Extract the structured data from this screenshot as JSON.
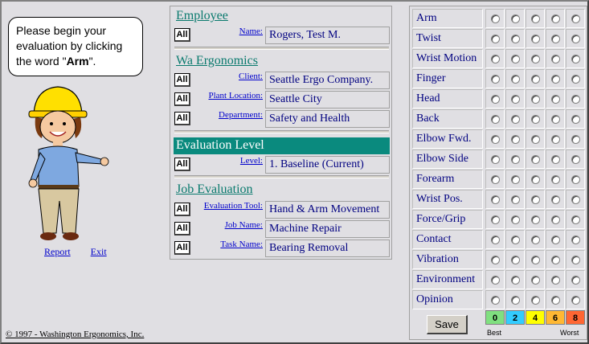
{
  "bubble": {
    "text_pre": "Please begin your evaluation by clicking the word \"",
    "text_bold": "Arm",
    "text_post": "\"."
  },
  "links": {
    "report": "Report",
    "exit": "Exit"
  },
  "copyright": "© 1997 - Washington Ergonomics, Inc.",
  "employee": {
    "section": "Employee",
    "all": "All",
    "name_label": "Name:",
    "name_value": "Rogers, Test M."
  },
  "company": {
    "section": "Wa Ergonomics",
    "client_label": "Client:",
    "client_value": "Seattle Ergo Company.",
    "plant_label": "Plant Location:",
    "plant_value": "Seattle City",
    "dept_label": "Department:",
    "dept_value": "Safety and Health"
  },
  "evaluation": {
    "section": "Evaluation Level",
    "level_label": "Level:",
    "level_value": "1. Baseline (Current)"
  },
  "job": {
    "section": "Job Evaluation",
    "tool_label": "Evaluation Tool:",
    "tool_value": "Hand & Arm Movement",
    "jobname_label": "Job Name:",
    "jobname_value": "Machine Repair",
    "task_label": "Task Name:",
    "task_value": "Bearing Removal"
  },
  "factors": [
    "Arm",
    "Twist",
    "Wrist Motion",
    "Finger",
    "Head",
    "Back",
    "Elbow Fwd.",
    "Elbow Side",
    "Forearm",
    "Wrist Pos.",
    "Force/Grip",
    "Contact",
    "Vibration",
    "Environment",
    "Opinion"
  ],
  "save_label": "Save",
  "scale": [
    {
      "v": "0",
      "color": "#80e080"
    },
    {
      "v": "2",
      "color": "#33ccff"
    },
    {
      "v": "4",
      "color": "#ffff00"
    },
    {
      "v": "6",
      "color": "#ffb833"
    },
    {
      "v": "8",
      "color": "#ff6633"
    }
  ],
  "scale_best": "Best",
  "scale_worst": "Worst"
}
